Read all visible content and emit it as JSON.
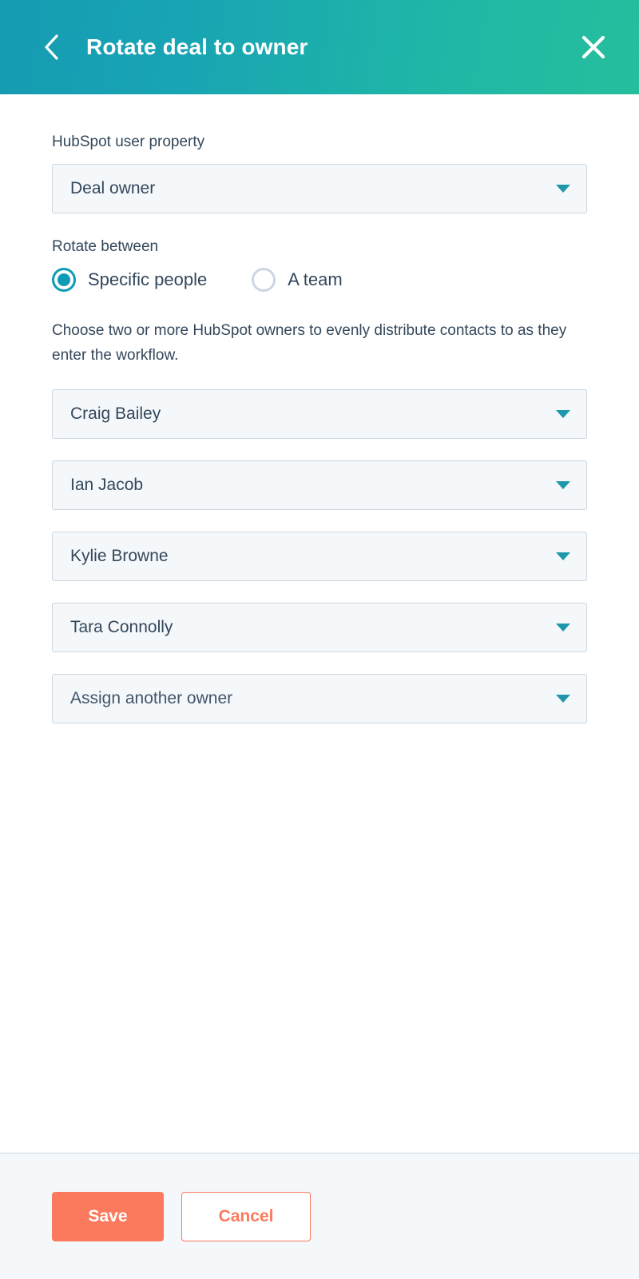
{
  "header": {
    "title": "Rotate deal to owner",
    "back_icon": "chevron-left-icon",
    "close_icon": "close-x-icon",
    "gradient_start": "#159bb3",
    "gradient_end": "#25bf9d"
  },
  "form": {
    "property_label": "HubSpot user property",
    "property_value": "Deal owner",
    "rotate_between_label": "Rotate between",
    "radio_options": [
      {
        "label": "Specific people",
        "selected": true
      },
      {
        "label": "A team",
        "selected": false
      }
    ],
    "helper_text": "Choose two or more HubSpot owners to evenly distribute contacts to as they enter the workflow.",
    "owners": [
      {
        "value": "Craig Bailey",
        "placeholder": false
      },
      {
        "value": "Ian Jacob",
        "placeholder": false
      },
      {
        "value": "Kylie Browne",
        "placeholder": false
      },
      {
        "value": "Tara Connolly",
        "placeholder": false
      },
      {
        "value": "Assign another owner",
        "placeholder": true
      }
    ],
    "caret_icon": "caret-down-icon",
    "caret_color": "#1f97ab",
    "field_bg": "#f5f8fa",
    "field_border": "#cbd6e2",
    "text_color": "#33475b",
    "radio_selected_color": "#0e9bb5",
    "radio_unselected_color": "#cbd6e2"
  },
  "footer": {
    "save_label": "Save",
    "cancel_label": "Cancel",
    "primary_color": "#fb7a5e",
    "background": "#f5f8fa"
  }
}
